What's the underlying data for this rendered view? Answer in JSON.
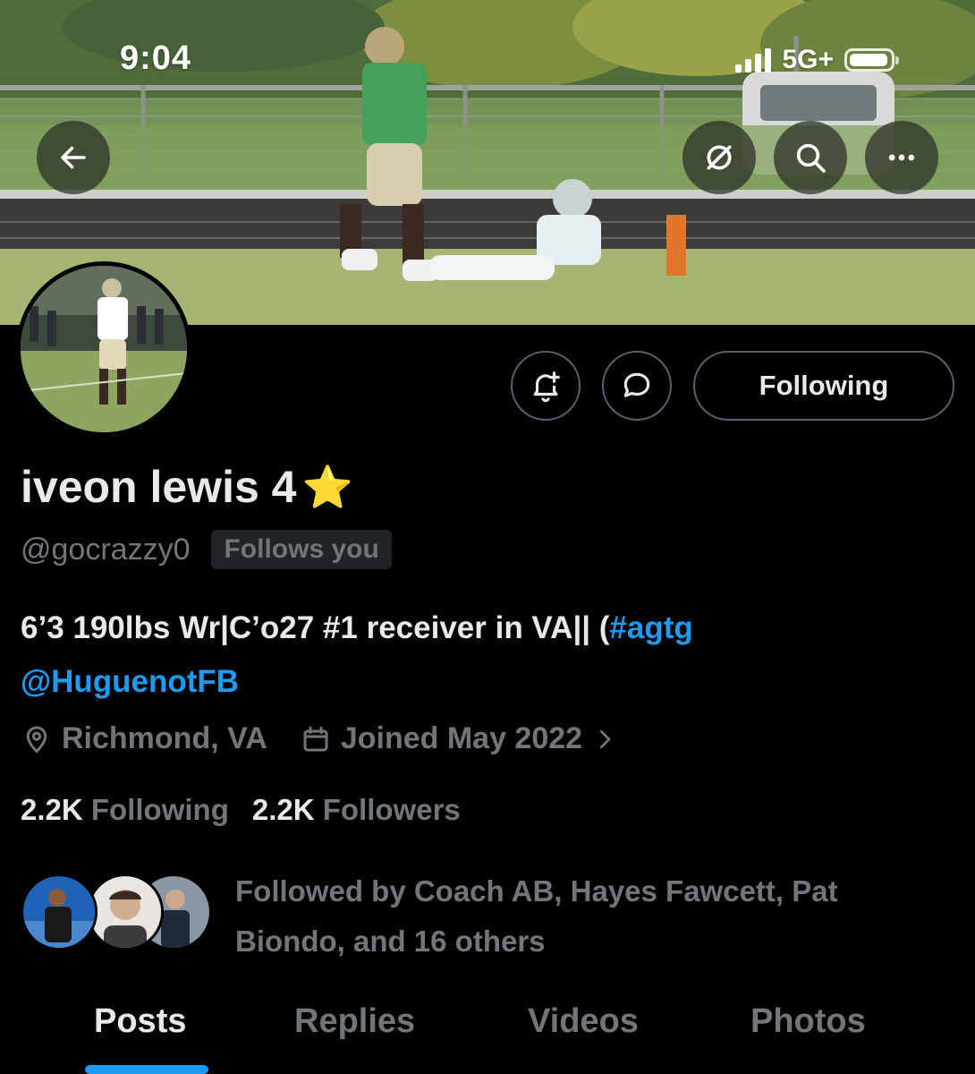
{
  "status_bar": {
    "time": "9:04",
    "network": "5G+",
    "battery_level": 0.95
  },
  "banner": {
    "back_icon": "arrow-left-icon",
    "grok_icon": "slashed-circle-icon",
    "search_icon": "search-icon",
    "more_icon": "more-horizontal-icon"
  },
  "actions": {
    "notify_icon": "bell-plus-icon",
    "message_icon": "message-bubble-icon",
    "following_label": "Following"
  },
  "profile": {
    "name": "iveon lewis 4",
    "name_emoji": "⭐",
    "handle": "@gocrazzy0",
    "follows_you": "Follows you",
    "bio_text": "6’3 190lbs Wr|C’o27 #1 receiver in VA|| (",
    "bio_hashtag": "#agtg",
    "bio_mention": "@HuguenotFB",
    "location": "Richmond, VA",
    "joined": "Joined May 2022",
    "following_count": "2.2K",
    "following_label": "Following",
    "followers_count": "2.2K",
    "followers_label": "Followers",
    "followed_by": "Followed by Coach AB, Hayes Fawcett, Pat Biondo, and 16 others"
  },
  "tabs": [
    {
      "label": "Posts",
      "active": true
    },
    {
      "label": "Replies",
      "active": false
    },
    {
      "label": "Videos",
      "active": false
    },
    {
      "label": "Photos",
      "active": false
    }
  ],
  "colors": {
    "accent": "#1d9bf0",
    "muted": "#71767b",
    "border": "#536471"
  }
}
